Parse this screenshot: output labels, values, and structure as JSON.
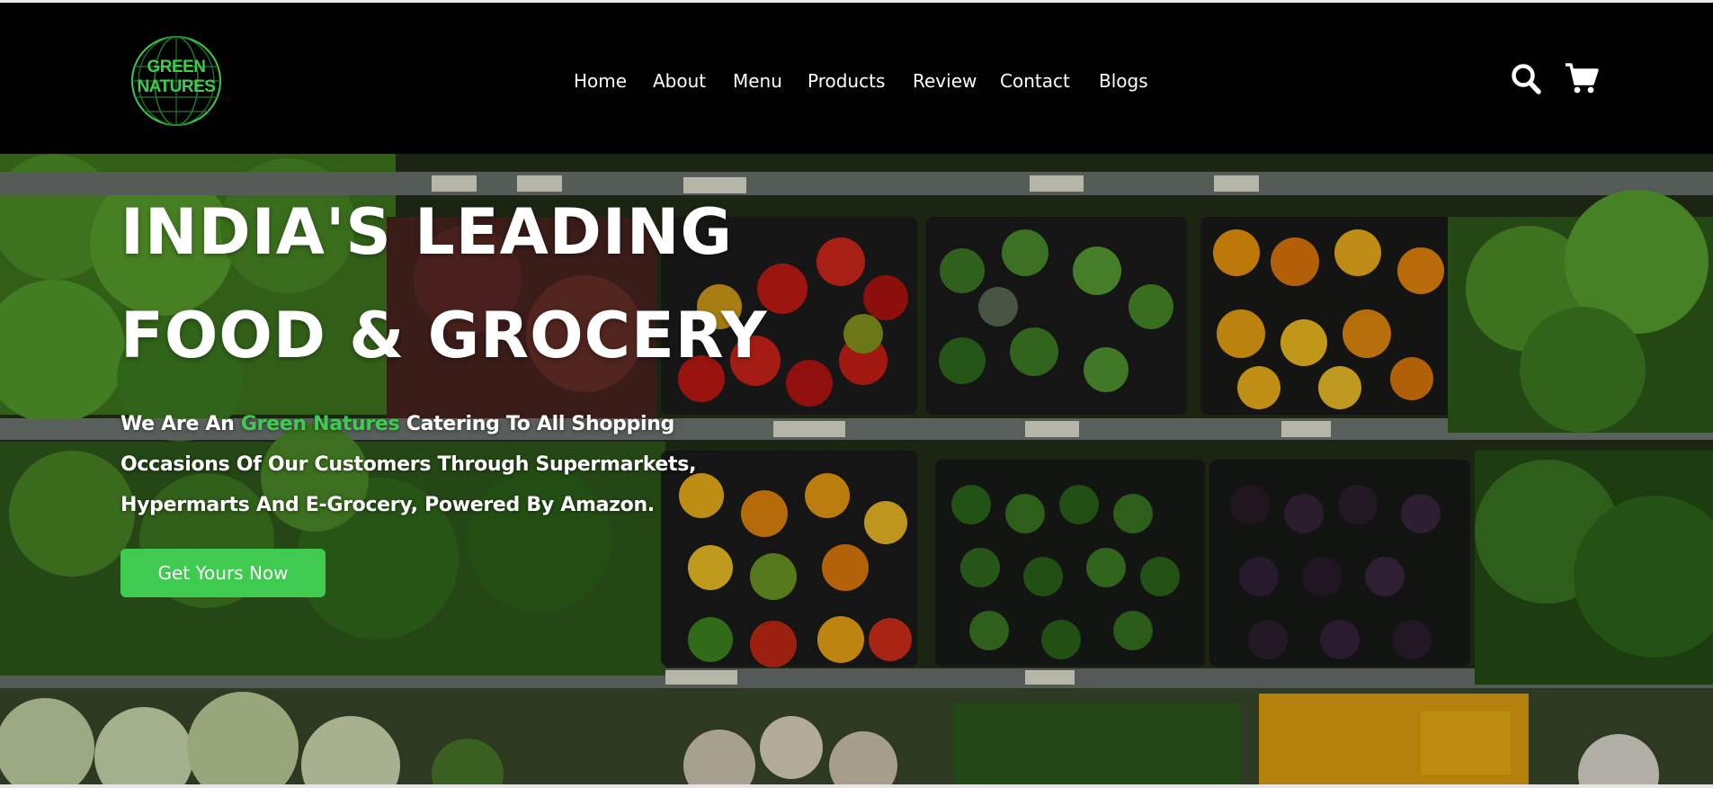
{
  "colors": {
    "accent": "#3ecb4f",
    "header_bg": "#000000",
    "text": "#ffffff"
  },
  "logo": {
    "line1": "GREEN",
    "line2": "NATURES",
    "icon": "globe-icon"
  },
  "nav": {
    "items": [
      {
        "label": "Home"
      },
      {
        "label": "About"
      },
      {
        "label": "Menu"
      },
      {
        "label": "Products"
      },
      {
        "label": "Review"
      },
      {
        "label": "Contact"
      },
      {
        "label": "Blogs"
      }
    ]
  },
  "header_icons": {
    "search": "search-icon",
    "cart": "cart-icon"
  },
  "hero": {
    "title_line1": "INDIA'S LEADING",
    "title_line2": "FOOD & GROCERY",
    "desc_prefix": "We Are An ",
    "desc_brand": "Green Natures",
    "desc_suffix": " Catering To All Shopping Occasions Of Our Customers Through Supermarkets, Hypermarts And E-Grocery, Powered By Amazon.",
    "cta_label": "Get Yours Now",
    "background": "grocery-shelves-image"
  }
}
